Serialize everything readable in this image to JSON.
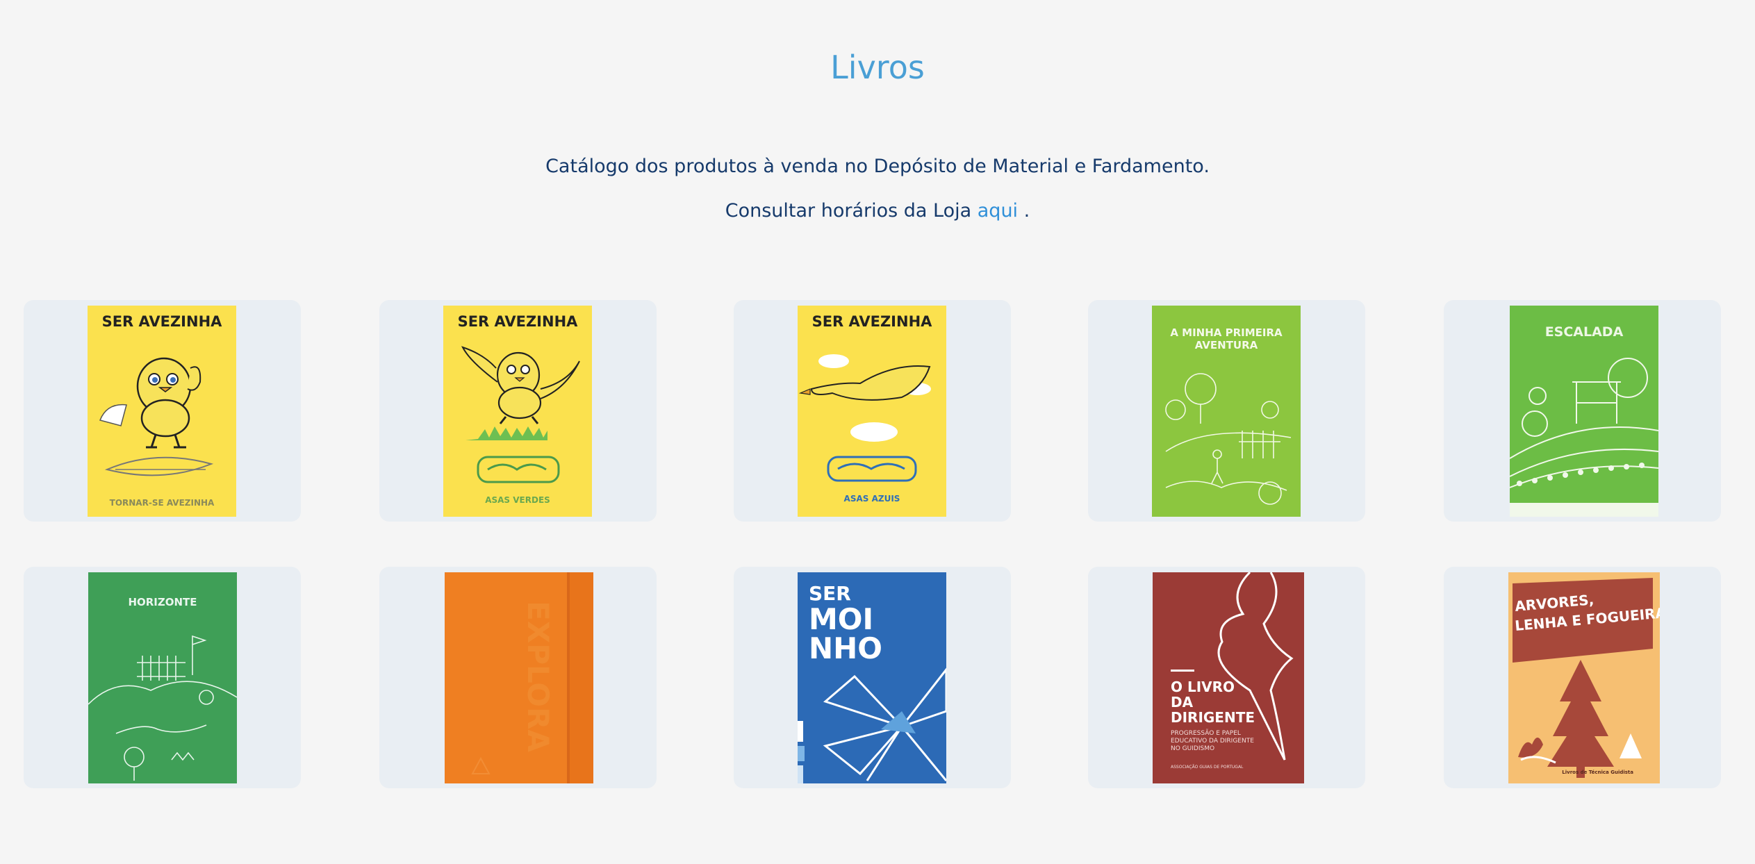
{
  "page": {
    "title": "Livros",
    "intro": "Catálogo dos produtos à venda no Depósito de Material e Fardamento.",
    "hours_prefix": "Consultar horários da Loja",
    "hours_link": "aqui",
    "hours_suffix": "."
  },
  "products": [
    {
      "cover_title": "SER AVEZINHA",
      "cover_subtitle": "TORNAR-SE AVEZINHA",
      "cover_color": "#fbe14e"
    },
    {
      "cover_title": "SER AVEZINHA",
      "cover_subtitle": "ASAS VERDES",
      "cover_color": "#fbe14e"
    },
    {
      "cover_title": "SER AVEZINHA",
      "cover_subtitle": "ASAS AZUIS",
      "cover_color": "#fbe14e"
    },
    {
      "cover_title_line1": "A MINHA PRIMEIRA",
      "cover_title_line2": "AVENTURA",
      "cover_color": "#8cc63f"
    },
    {
      "cover_title": "ESCALADA",
      "cover_color": "#6cbd45"
    },
    {
      "cover_title": "HORIZONTE",
      "cover_color": "#3f9f57"
    },
    {
      "cover_spine_text": "EXPLORA",
      "cover_color": "#ef7f22"
    },
    {
      "cover_title_line1": "SER",
      "cover_title_line2": "MOI",
      "cover_title_line3": "NHO",
      "cover_color": "#2c6ab6"
    },
    {
      "cover_title_line1": "O LIVRO",
      "cover_title_line2": "DA",
      "cover_title_line3": "DIRIGENTE",
      "cover_sub1": "PROGRESSÃO E PAPEL",
      "cover_sub2": "EDUCATIVO DA DIRIGENTE",
      "cover_sub3": "NO GUIDISMO",
      "cover_publisher": "ASSOCIAÇÃO GUIAS DE PORTUGAL",
      "cover_color": "#9b3b36"
    },
    {
      "cover_title_line1": "ARVORES,",
      "cover_title_line2": "LENHA E FOGUEIRAS",
      "cover_series": "Livros de Técnica Guidista",
      "cover_color": "#f6bf72"
    }
  ]
}
